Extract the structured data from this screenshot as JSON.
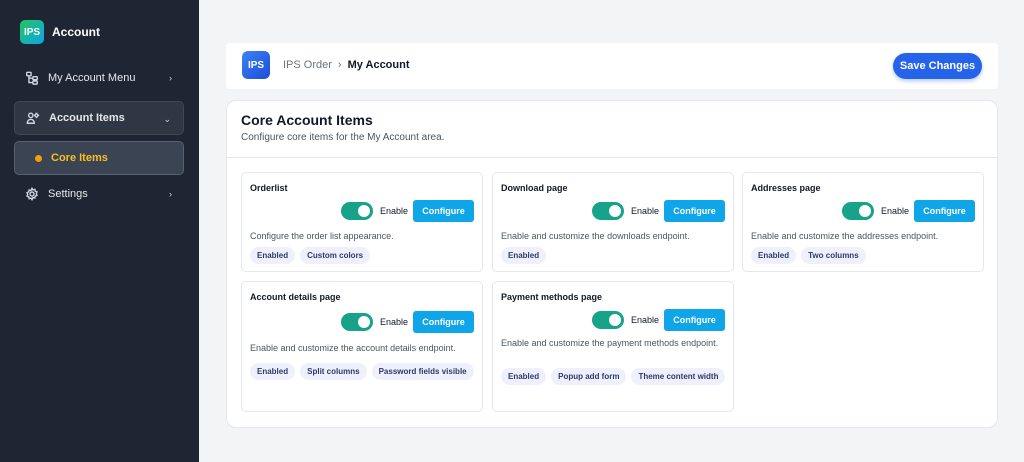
{
  "sidebar": {
    "brand_logo": "IPS",
    "brand_name": "Account",
    "items": [
      {
        "label": "My Account Menu",
        "icon": "sitemap-icon"
      },
      {
        "label": "Account Items",
        "icon": "user-gear-icon"
      },
      {
        "label": "Core Items"
      },
      {
        "label": "Settings",
        "icon": "gear-icon"
      }
    ]
  },
  "header": {
    "logo": "IPS",
    "breadcrumb_root": "IPS Order",
    "breadcrumb_sep": "›",
    "breadcrumb_current": "My Account",
    "save_label": "Save Changes"
  },
  "panel": {
    "title": "Core Account Items",
    "subtitle": "Configure core items for the My Account area."
  },
  "cards": [
    {
      "title": "Orderlist",
      "enable_label": "Enable",
      "configure_label": "Configure",
      "enabled": true,
      "description": "Configure the order list appearance.",
      "badges": [
        "Enabled",
        "Custom colors"
      ]
    },
    {
      "title": "Download page",
      "enable_label": "Enable",
      "configure_label": "Configure",
      "enabled": true,
      "description": "Enable and customize the downloads endpoint.",
      "badges": [
        "Enabled"
      ]
    },
    {
      "title": "Addresses page",
      "enable_label": "Enable",
      "configure_label": "Configure",
      "enabled": true,
      "description": "Enable and customize the addresses endpoint.",
      "badges": [
        "Enabled",
        "Two columns"
      ]
    },
    {
      "title": "Account details page",
      "enable_label": "Enable",
      "configure_label": "Configure",
      "enabled": true,
      "description": "Enable and customize the account details endpoint.",
      "badges": [
        "Enabled",
        "Split columns",
        "Password fields visible"
      ]
    },
    {
      "title": "Payment methods page",
      "enable_label": "Enable",
      "configure_label": "Configure",
      "enabled": true,
      "description": "Enable and customize the payment methods endpoint.",
      "badges": [
        "Enabled",
        "Popup add form",
        "Theme content width"
      ]
    }
  ],
  "colors": {
    "sidebar_bg": "#1f2633",
    "accent_blue": "#2563eb",
    "configure_blue": "#0ea5e9",
    "toggle_on": "#16a38a",
    "active_dot": "#f59e0b"
  }
}
